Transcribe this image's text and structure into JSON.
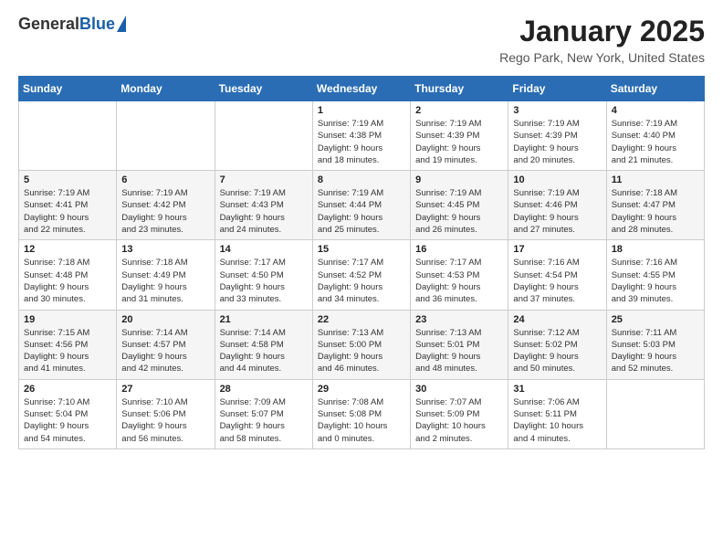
{
  "header": {
    "logo_general": "General",
    "logo_blue": "Blue",
    "month_title": "January 2025",
    "location": "Rego Park, New York, United States"
  },
  "weekdays": [
    "Sunday",
    "Monday",
    "Tuesday",
    "Wednesday",
    "Thursday",
    "Friday",
    "Saturday"
  ],
  "weeks": [
    [
      {
        "day": "",
        "info": ""
      },
      {
        "day": "",
        "info": ""
      },
      {
        "day": "",
        "info": ""
      },
      {
        "day": "1",
        "info": "Sunrise: 7:19 AM\nSunset: 4:38 PM\nDaylight: 9 hours\nand 18 minutes."
      },
      {
        "day": "2",
        "info": "Sunrise: 7:19 AM\nSunset: 4:39 PM\nDaylight: 9 hours\nand 19 minutes."
      },
      {
        "day": "3",
        "info": "Sunrise: 7:19 AM\nSunset: 4:39 PM\nDaylight: 9 hours\nand 20 minutes."
      },
      {
        "day": "4",
        "info": "Sunrise: 7:19 AM\nSunset: 4:40 PM\nDaylight: 9 hours\nand 21 minutes."
      }
    ],
    [
      {
        "day": "5",
        "info": "Sunrise: 7:19 AM\nSunset: 4:41 PM\nDaylight: 9 hours\nand 22 minutes."
      },
      {
        "day": "6",
        "info": "Sunrise: 7:19 AM\nSunset: 4:42 PM\nDaylight: 9 hours\nand 23 minutes."
      },
      {
        "day": "7",
        "info": "Sunrise: 7:19 AM\nSunset: 4:43 PM\nDaylight: 9 hours\nand 24 minutes."
      },
      {
        "day": "8",
        "info": "Sunrise: 7:19 AM\nSunset: 4:44 PM\nDaylight: 9 hours\nand 25 minutes."
      },
      {
        "day": "9",
        "info": "Sunrise: 7:19 AM\nSunset: 4:45 PM\nDaylight: 9 hours\nand 26 minutes."
      },
      {
        "day": "10",
        "info": "Sunrise: 7:19 AM\nSunset: 4:46 PM\nDaylight: 9 hours\nand 27 minutes."
      },
      {
        "day": "11",
        "info": "Sunrise: 7:18 AM\nSunset: 4:47 PM\nDaylight: 9 hours\nand 28 minutes."
      }
    ],
    [
      {
        "day": "12",
        "info": "Sunrise: 7:18 AM\nSunset: 4:48 PM\nDaylight: 9 hours\nand 30 minutes."
      },
      {
        "day": "13",
        "info": "Sunrise: 7:18 AM\nSunset: 4:49 PM\nDaylight: 9 hours\nand 31 minutes."
      },
      {
        "day": "14",
        "info": "Sunrise: 7:17 AM\nSunset: 4:50 PM\nDaylight: 9 hours\nand 33 minutes."
      },
      {
        "day": "15",
        "info": "Sunrise: 7:17 AM\nSunset: 4:52 PM\nDaylight: 9 hours\nand 34 minutes."
      },
      {
        "day": "16",
        "info": "Sunrise: 7:17 AM\nSunset: 4:53 PM\nDaylight: 9 hours\nand 36 minutes."
      },
      {
        "day": "17",
        "info": "Sunrise: 7:16 AM\nSunset: 4:54 PM\nDaylight: 9 hours\nand 37 minutes."
      },
      {
        "day": "18",
        "info": "Sunrise: 7:16 AM\nSunset: 4:55 PM\nDaylight: 9 hours\nand 39 minutes."
      }
    ],
    [
      {
        "day": "19",
        "info": "Sunrise: 7:15 AM\nSunset: 4:56 PM\nDaylight: 9 hours\nand 41 minutes."
      },
      {
        "day": "20",
        "info": "Sunrise: 7:14 AM\nSunset: 4:57 PM\nDaylight: 9 hours\nand 42 minutes."
      },
      {
        "day": "21",
        "info": "Sunrise: 7:14 AM\nSunset: 4:58 PM\nDaylight: 9 hours\nand 44 minutes."
      },
      {
        "day": "22",
        "info": "Sunrise: 7:13 AM\nSunset: 5:00 PM\nDaylight: 9 hours\nand 46 minutes."
      },
      {
        "day": "23",
        "info": "Sunrise: 7:13 AM\nSunset: 5:01 PM\nDaylight: 9 hours\nand 48 minutes."
      },
      {
        "day": "24",
        "info": "Sunrise: 7:12 AM\nSunset: 5:02 PM\nDaylight: 9 hours\nand 50 minutes."
      },
      {
        "day": "25",
        "info": "Sunrise: 7:11 AM\nSunset: 5:03 PM\nDaylight: 9 hours\nand 52 minutes."
      }
    ],
    [
      {
        "day": "26",
        "info": "Sunrise: 7:10 AM\nSunset: 5:04 PM\nDaylight: 9 hours\nand 54 minutes."
      },
      {
        "day": "27",
        "info": "Sunrise: 7:10 AM\nSunset: 5:06 PM\nDaylight: 9 hours\nand 56 minutes."
      },
      {
        "day": "28",
        "info": "Sunrise: 7:09 AM\nSunset: 5:07 PM\nDaylight: 9 hours\nand 58 minutes."
      },
      {
        "day": "29",
        "info": "Sunrise: 7:08 AM\nSunset: 5:08 PM\nDaylight: 10 hours\nand 0 minutes."
      },
      {
        "day": "30",
        "info": "Sunrise: 7:07 AM\nSunset: 5:09 PM\nDaylight: 10 hours\nand 2 minutes."
      },
      {
        "day": "31",
        "info": "Sunrise: 7:06 AM\nSunset: 5:11 PM\nDaylight: 10 hours\nand 4 minutes."
      },
      {
        "day": "",
        "info": ""
      }
    ]
  ]
}
